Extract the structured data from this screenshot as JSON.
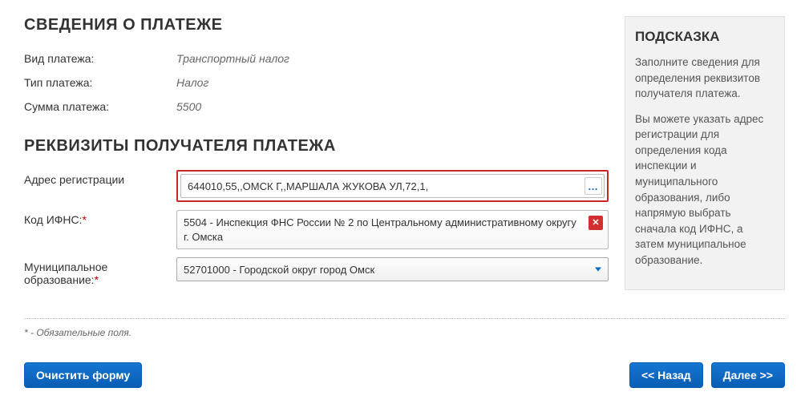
{
  "section1": {
    "title": "СВЕДЕНИЯ О ПЛАТЕЖЕ",
    "rows": {
      "pay_type_label": "Вид платежа:",
      "pay_type_value": "Транспортный налог",
      "pay_kind_label": "Тип платежа:",
      "pay_kind_value": "Налог",
      "pay_sum_label": "Сумма платежа:",
      "pay_sum_value": "5500"
    }
  },
  "section2": {
    "title": "РЕКВИЗИТЫ ПОЛУЧАТЕЛЯ ПЛАТЕЖА",
    "address_label": "Адрес регистрации",
    "address_value": "644010,55,,ОМСК Г,,МАРШАЛА ЖУКОВА УЛ,72,1,",
    "ifns_label": "Код ИФНС:",
    "ifns_value": "5504 - Инспекция ФНС России № 2 по Центральному административному округу г. Омска",
    "munic_label": "Муниципальное образование:",
    "munic_value": "52701000 - Городской округ город Омск"
  },
  "hint": {
    "title": "ПОДСКАЗКА",
    "p1": "Заполните сведения для определения реквизитов получателя платежа.",
    "p2": "Вы можете указать адрес регистрации для определения кода инспекции и муниципального образования, либо напрямую выбрать сначала код ИФНС, а затем муниципальное образование."
  },
  "footnote": "* - Обязательные поля.",
  "buttons": {
    "clear": "Очистить форму",
    "back": "<< Назад",
    "next": "Далее >>"
  },
  "icons": {
    "ellipsis": "…"
  }
}
